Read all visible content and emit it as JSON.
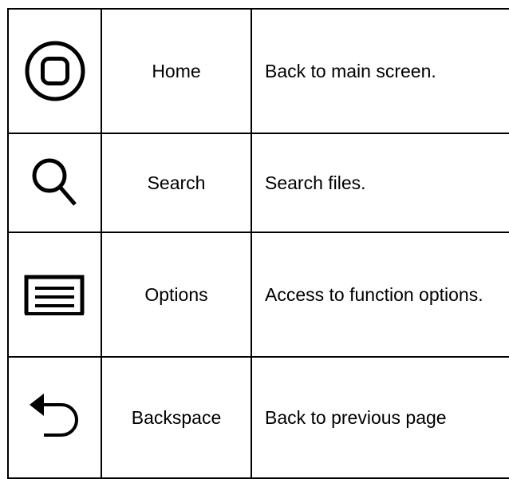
{
  "rows": [
    {
      "icon": "home-icon",
      "name": "Home",
      "description": "Back to main screen."
    },
    {
      "icon": "search-icon",
      "name": "Search",
      "description": "Search files."
    },
    {
      "icon": "menu-icon",
      "name": "Options",
      "description": "Access to function options."
    },
    {
      "icon": "back-arrow-icon",
      "name": "Backspace",
      "description": "Back to previous page"
    }
  ]
}
